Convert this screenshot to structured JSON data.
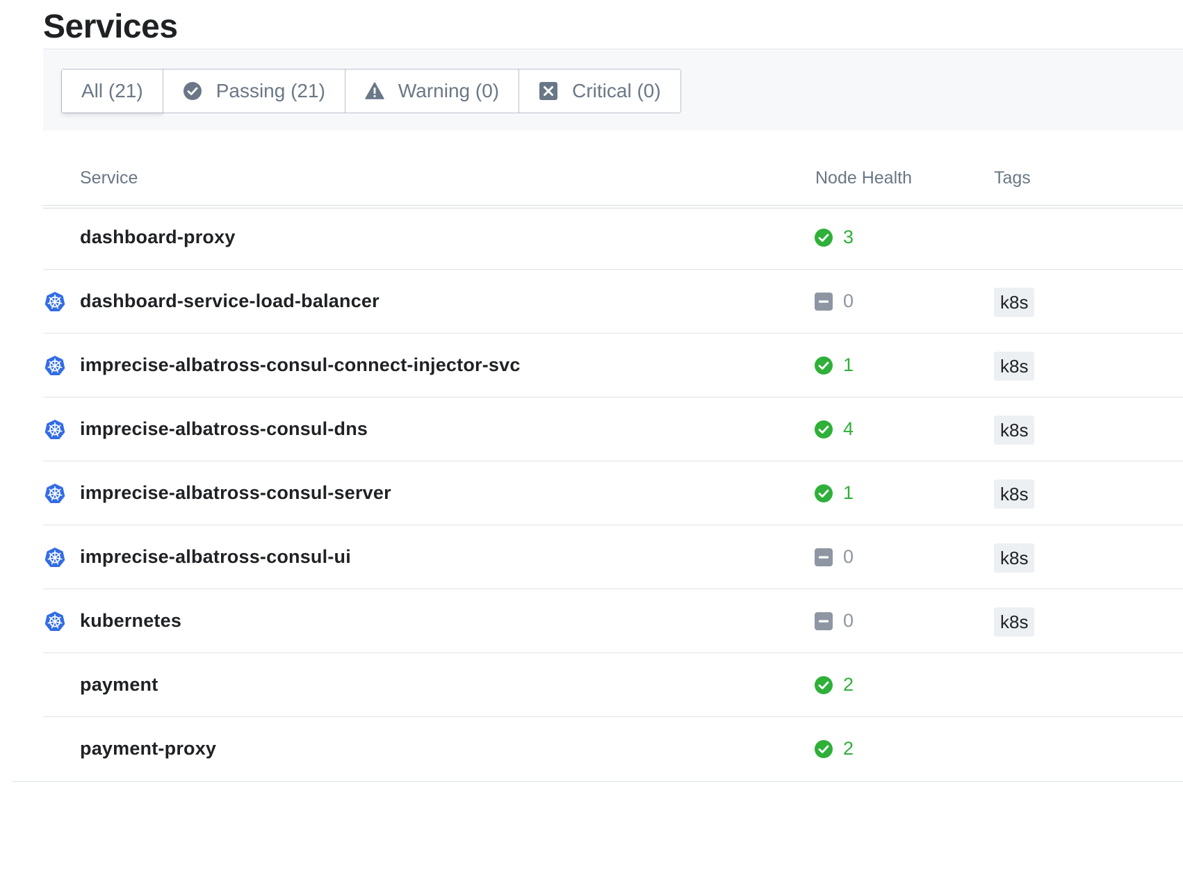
{
  "page": {
    "title": "Services"
  },
  "filters": [
    {
      "label": "All (21)",
      "icon": ""
    },
    {
      "label": "Passing (21)",
      "icon": "check-circle-icon"
    },
    {
      "label": "Warning (0)",
      "icon": "warning-icon"
    },
    {
      "label": "Critical (0)",
      "icon": "critical-x-icon"
    }
  ],
  "table": {
    "columns": {
      "service": "Service",
      "health": "Node Health",
      "tags": "Tags"
    },
    "rows": [
      {
        "name": "dashboard-proxy",
        "k8s": false,
        "health_status": "passing",
        "health_count": "3",
        "tag": ""
      },
      {
        "name": "dashboard-service-load-balancer",
        "k8s": true,
        "health_status": "none",
        "health_count": "0",
        "tag": "k8s"
      },
      {
        "name": "imprecise-albatross-consul-connect-injector-svc",
        "k8s": true,
        "health_status": "passing",
        "health_count": "1",
        "tag": "k8s"
      },
      {
        "name": "imprecise-albatross-consul-dns",
        "k8s": true,
        "health_status": "passing",
        "health_count": "4",
        "tag": "k8s"
      },
      {
        "name": "imprecise-albatross-consul-server",
        "k8s": true,
        "health_status": "passing",
        "health_count": "1",
        "tag": "k8s"
      },
      {
        "name": "imprecise-albatross-consul-ui",
        "k8s": true,
        "health_status": "none",
        "health_count": "0",
        "tag": "k8s"
      },
      {
        "name": "kubernetes",
        "k8s": true,
        "health_status": "none",
        "health_count": "0",
        "tag": "k8s"
      },
      {
        "name": "payment",
        "k8s": false,
        "health_status": "passing",
        "health_count": "2",
        "tag": ""
      },
      {
        "name": "payment-proxy",
        "k8s": false,
        "health_status": "passing",
        "health_count": "2",
        "tag": ""
      }
    ]
  },
  "colors": {
    "passing": "#2eb039",
    "neutral": "#8e96a3",
    "k8s_blue": "#326ce5",
    "muted_text": "#6a7786"
  }
}
